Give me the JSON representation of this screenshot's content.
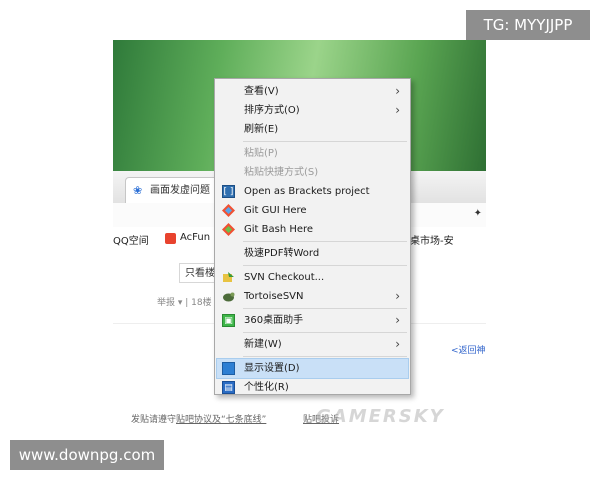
{
  "badges": {
    "top": "TG: MYYJJPP",
    "bottom": "www.downpg.com"
  },
  "browser": {
    "tab_title": "画面发虚问题",
    "bookmarks": [
      "QQ空间",
      "AcFun",
      "桌市场-安"
    ],
    "only_button": "只看楼",
    "report_text": "举报 ▾ | 18楼",
    "back_link": "<返回神",
    "post_rules_prefix": "发贴请遵守",
    "post_rules_link": "贴吧协议及“七条底线”",
    "complain_link": "贴吧投诉",
    "site_watermark": "GAMERSKY"
  },
  "context_menu": {
    "items": [
      {
        "label": "查看(V)",
        "submenu": true,
        "enabled": true,
        "icon": "none"
      },
      {
        "label": "排序方式(O)",
        "submenu": true,
        "enabled": true,
        "icon": "none"
      },
      {
        "label": "刷新(E)",
        "submenu": false,
        "enabled": true,
        "icon": "none"
      },
      {
        "label": "粘贴(P)",
        "submenu": false,
        "enabled": false,
        "icon": "none"
      },
      {
        "label": "粘贴快捷方式(S)",
        "submenu": false,
        "enabled": false,
        "icon": "none"
      },
      {
        "label": "Open as Brackets project",
        "submenu": false,
        "enabled": true,
        "icon": "brackets-icon"
      },
      {
        "label": "Git GUI Here",
        "submenu": false,
        "enabled": true,
        "icon": "git-icon"
      },
      {
        "label": "Git Bash Here",
        "submenu": false,
        "enabled": true,
        "icon": "git-icon"
      },
      {
        "label": "极速PDF转Word",
        "submenu": false,
        "enabled": true,
        "icon": "none"
      },
      {
        "label": "SVN Checkout...",
        "submenu": false,
        "enabled": true,
        "icon": "svn-checkout-icon"
      },
      {
        "label": "TortoiseSVN",
        "submenu": true,
        "enabled": true,
        "icon": "tortoise-icon"
      },
      {
        "label": "360桌面助手",
        "submenu": true,
        "enabled": true,
        "icon": "360-icon"
      },
      {
        "label": "新建(W)",
        "submenu": true,
        "enabled": true,
        "icon": "none"
      },
      {
        "label": "显示设置(D)",
        "submenu": false,
        "enabled": true,
        "icon": "display-icon",
        "highlighted": true
      },
      {
        "label": "个性化(R)",
        "submenu": false,
        "enabled": true,
        "icon": "personalize-icon"
      }
    ]
  },
  "colors": {
    "menu_bg": "#f2f2f2",
    "menu_highlight": "#c9e0f7",
    "disabled_text": "#9b9b9b",
    "badge_bg": "#8e8e8e"
  }
}
